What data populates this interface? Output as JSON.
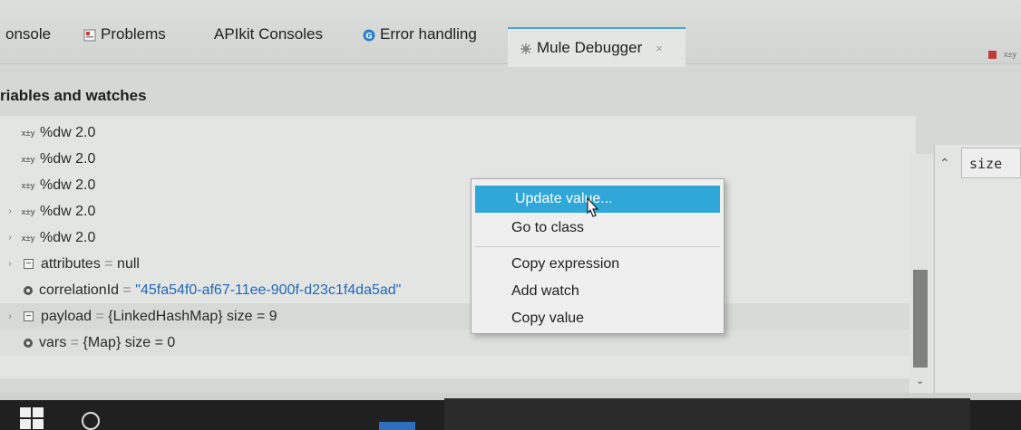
{
  "tabs": [
    {
      "label": "onsole",
      "icon": "none"
    },
    {
      "label": "Problems",
      "icon": "problems-icon"
    },
    {
      "label": "APIkit Consoles",
      "icon": "none"
    },
    {
      "label": "Error handling",
      "icon": "error-handling-icon"
    },
    {
      "label": "Mule Debugger",
      "icon": "mule-debugger-icon",
      "active": true,
      "close": "×"
    }
  ],
  "panel": {
    "title": "riables and watches"
  },
  "tree": {
    "xy_glyph": "x±y",
    "rows": [
      {
        "label": "%dw 2.0",
        "type": "expression",
        "expandable": false
      },
      {
        "label": "%dw 2.0",
        "type": "expression",
        "expandable": false
      },
      {
        "label": "%dw 2.0",
        "type": "expression",
        "expandable": false
      },
      {
        "label": "%dw 2.0",
        "type": "expression",
        "expandable": true
      },
      {
        "label": "%dw 2.0",
        "type": "expression",
        "expandable": true
      },
      {
        "label": "attributes",
        "eq": " = ",
        "value": "null",
        "type": "object",
        "expandable": true
      },
      {
        "label": "correlationId",
        "eq": " = ",
        "value": "\"45fa54f0-af67-11ee-900f-d23c1f4da5ad\"",
        "type": "field",
        "expandable": false,
        "value_color": "#2267b8"
      },
      {
        "label": "payload",
        "eq": " = ",
        "value": "{LinkedHashMap} size = 9",
        "type": "object",
        "expandable": true
      },
      {
        "label": "vars",
        "eq": " = ",
        "value": "{Map} size = 0",
        "type": "field",
        "expandable": false
      }
    ]
  },
  "detail_pane": {
    "header": "size"
  },
  "context_menu": {
    "items": [
      {
        "label": "Update value...",
        "highlighted": true
      },
      {
        "label": "Go to class"
      },
      {
        "label": "Copy expression"
      },
      {
        "label": "Add watch"
      },
      {
        "label": "Copy value"
      }
    ]
  },
  "colors": {
    "accent": "#2fa7d9",
    "value_link": "#2267b8",
    "active_tab_border": "#4aa3c8"
  }
}
